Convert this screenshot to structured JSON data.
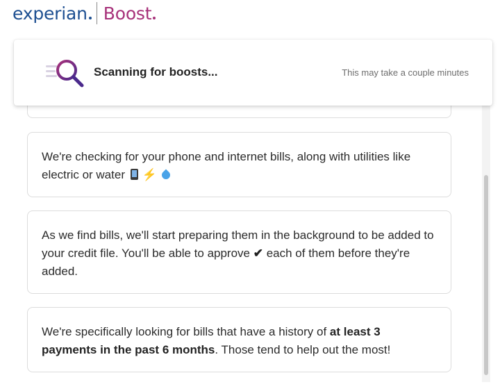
{
  "logo": {
    "experian": "experian",
    "boost": "Boost"
  },
  "scanning": {
    "title": "Scanning for boosts...",
    "subtitle": "This may take a couple minutes",
    "icon": "magnifier-icon"
  },
  "cards": [
    {
      "text_line1": "We're checking for your phone and internet bills, along with utilities like",
      "text_line2": "electric or water"
    },
    {
      "text_before": "As we find bills, we'll start preparing them in the background to be added to your credit file. You'll be able to approve",
      "check": "✔",
      "text_after": "each of them before they're added."
    },
    {
      "text_before": "We're specifically looking for bills that have a history of",
      "bold": "at least 3 payments in the past 6 months",
      "text_after": ". Those tend to help out the most!"
    }
  ],
  "colors": {
    "experian_blue": "#1d4f91",
    "boost_magenta": "#a7317a",
    "icon_purple": "#6a2a8c"
  }
}
